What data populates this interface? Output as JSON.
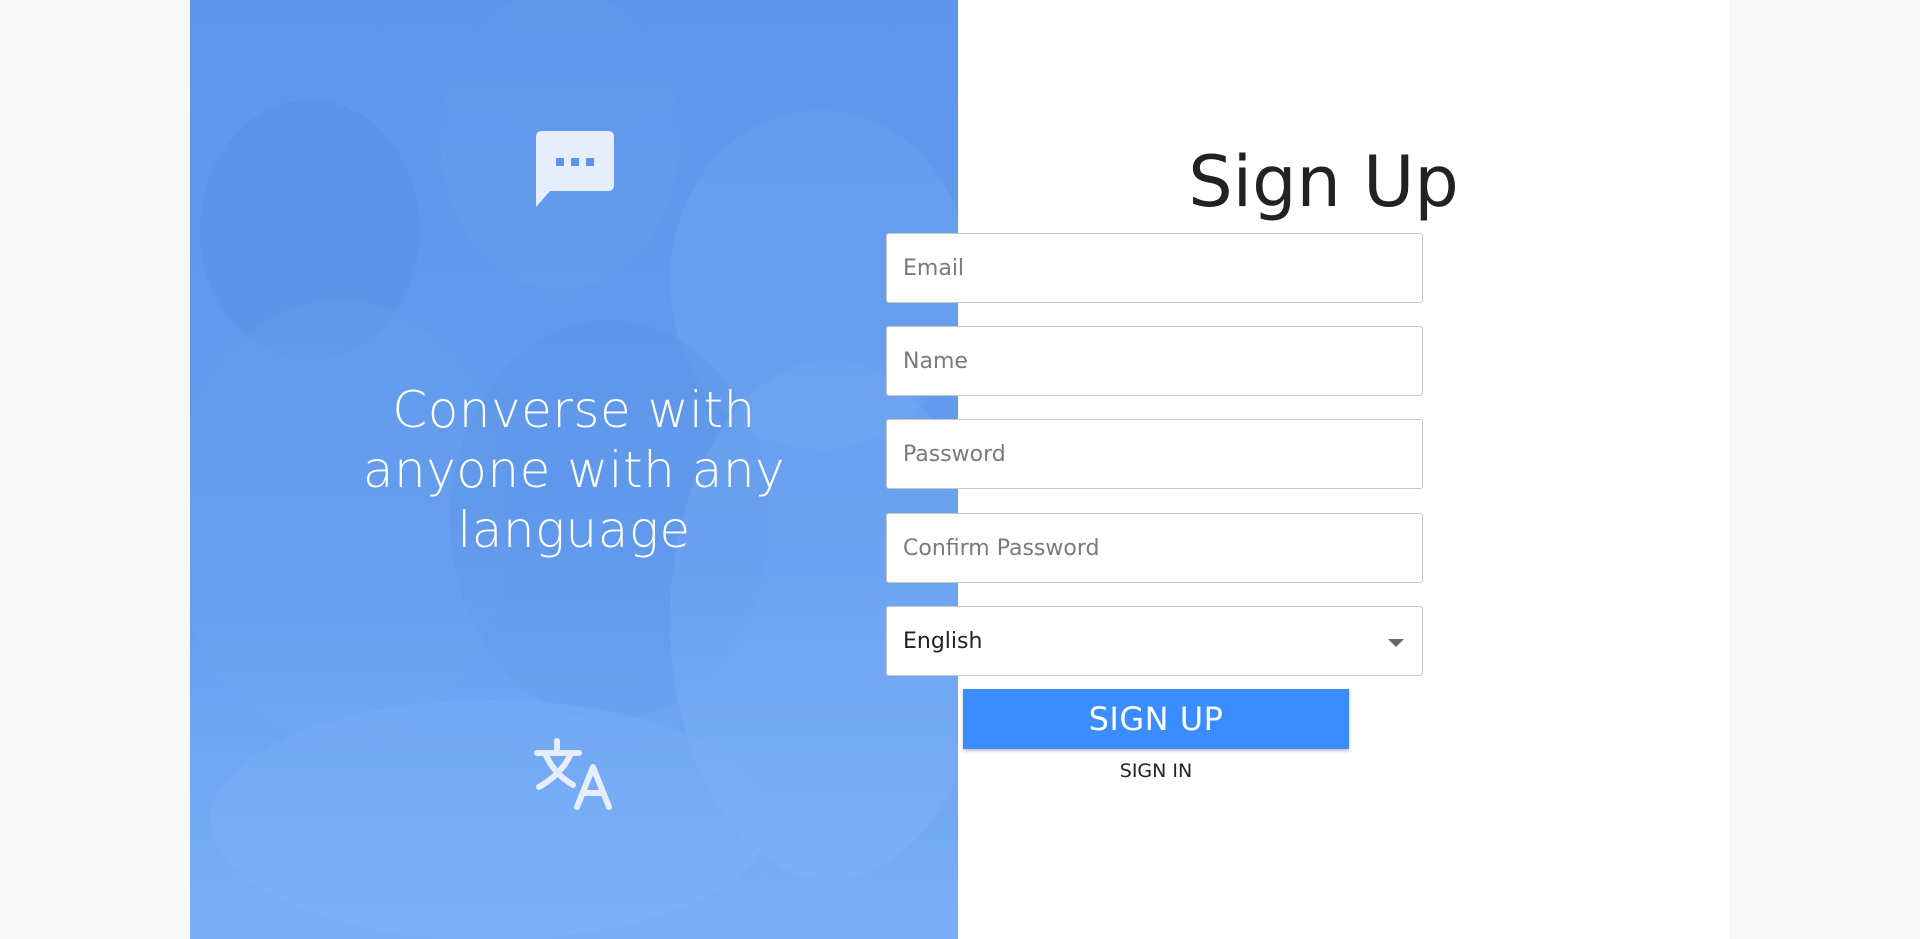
{
  "hero": {
    "tagline": "Converse with anyone with any language",
    "chat_icon": "chat-bubble-icon",
    "translate_icon": "translate-icon",
    "accent_color": "#5b95ea"
  },
  "form": {
    "title": "Sign Up",
    "email_placeholder": "Email",
    "name_placeholder": "Name",
    "password_placeholder": "Password",
    "confirm_password_placeholder": "Confirm Password",
    "language_selected": "English",
    "signup_label": "SIGN UP",
    "signin_label": "SIGN IN",
    "button_color": "#3a8cff"
  }
}
